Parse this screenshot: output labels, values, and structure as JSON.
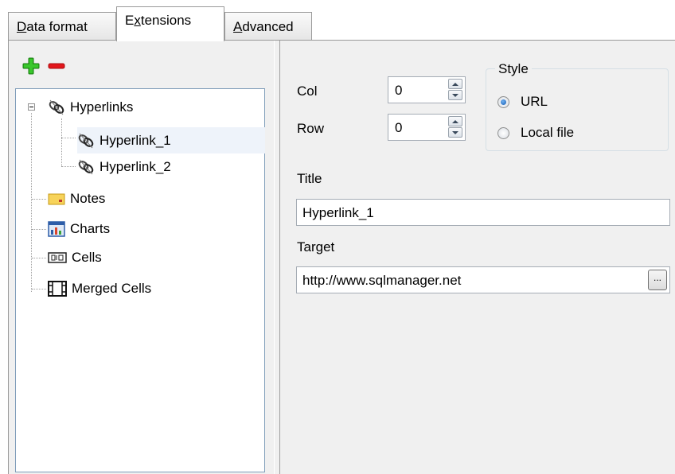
{
  "tabs": [
    {
      "accel": "D",
      "rest": "ata format"
    },
    {
      "pre": "E",
      "accel": "x",
      "rest": "tensions"
    },
    {
      "accel": "A",
      "rest": "dvanced"
    }
  ],
  "tree": {
    "hyperlinks": "Hyperlinks",
    "hyperlink_1": "Hyperlink_1",
    "hyperlink_2": "Hyperlink_2",
    "notes": "Notes",
    "charts": "Charts",
    "cells": "Cells",
    "merged_cells": "Merged Cells"
  },
  "form": {
    "col_label": "Col",
    "col_value": "0",
    "row_label": "Row",
    "row_value": "0",
    "style_title": "Style",
    "url_label": "URL",
    "local_file_label": "Local file",
    "title_label": "Title",
    "title_value": "Hyperlink_1",
    "target_label": "Target",
    "target_value": "http://www.sqlmanager.net",
    "browse_label": "..."
  },
  "colors": {
    "add": "#2bb31f",
    "remove": "#e3161b",
    "selection": "#eef3fa"
  }
}
